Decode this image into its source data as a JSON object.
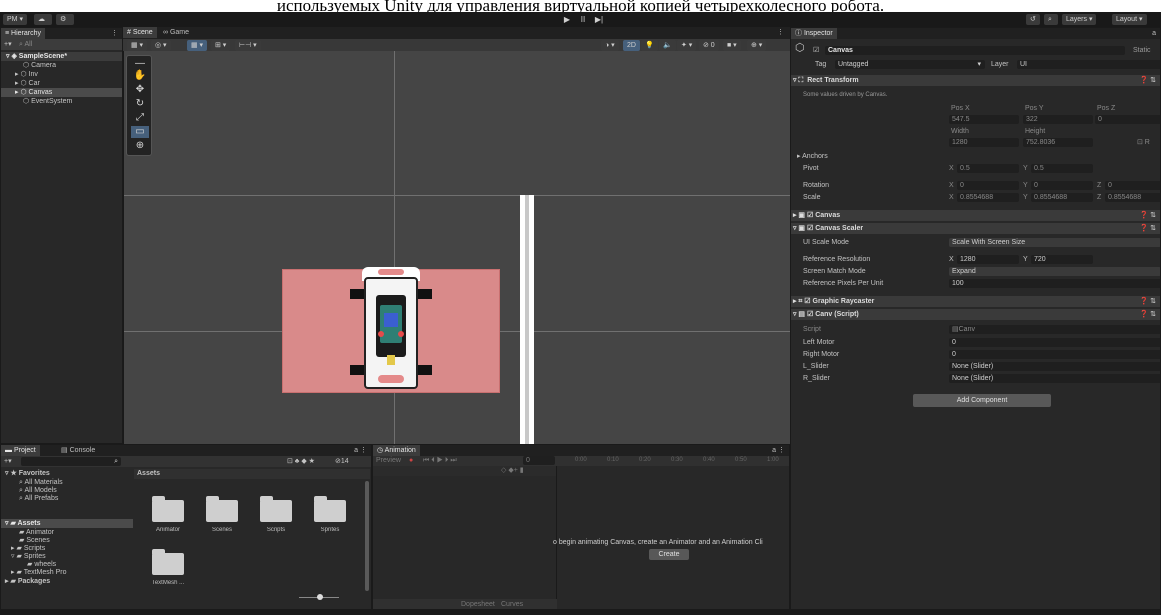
{
  "caption": "используемых Unity для управления виртуальной копией четырехколесного робота.",
  "toolbar": {
    "account": "PM ▾",
    "play_label": "▶",
    "pause_label": "II",
    "step_label": "▶|",
    "layers": "Layers",
    "layout": "Layout"
  },
  "hierarchy": {
    "tab": "Hierarchy",
    "search_placeholder": "All",
    "items": [
      {
        "label": "SampleScene*"
      },
      {
        "label": "Camera"
      },
      {
        "label": "Inv"
      },
      {
        "label": "Car"
      },
      {
        "label": "Canvas"
      },
      {
        "label": "EventSystem"
      }
    ]
  },
  "scene": {
    "tabs": [
      {
        "label": "Scene"
      },
      {
        "label": "Game"
      }
    ],
    "mode_2d": "2D"
  },
  "inspector": {
    "tab": "Inspector",
    "object_name": "Canvas",
    "static_label": "Static",
    "tag_label": "Tag",
    "tag_value": "Untagged",
    "layer_label": "Layer",
    "layer_value": "UI",
    "rect_transform": {
      "title": "Rect Transform",
      "note": "Some values driven by Canvas.",
      "posx_label": "Pos X",
      "posx": "547.5",
      "posy_label": "Pos Y",
      "posy": "322",
      "posz_label": "Pos Z",
      "posz": "0",
      "width_label": "Width",
      "width": "1280",
      "height_label": "Height",
      "height": "752.8036",
      "anchors": "Anchors",
      "pivot_label": "Pivot",
      "pivot_x": "0.5",
      "pivot_y": "0.5",
      "rotation_label": "Rotation",
      "rot_x": "0",
      "rot_y": "0",
      "rot_z": "0",
      "scale_label": "Scale",
      "scale_x": "0.8554688",
      "scale_y": "0.8554688",
      "scale_z": "0.8554688"
    },
    "canvas_title": "Canvas",
    "canvas_scaler": {
      "title": "Canvas Scaler",
      "ui_scale_mode_label": "UI Scale Mode",
      "ui_scale_mode": "Scale With Screen Size",
      "ref_res_label": "Reference Resolution",
      "ref_x": "1280",
      "ref_y": "720",
      "match_mode_label": "Screen Match Mode",
      "match_mode": "Expand",
      "ppu_label": "Reference Pixels Per Unit",
      "ppu": "100"
    },
    "graphic_raycaster": "Graphic Raycaster",
    "canv_script": {
      "title": "Canv (Script)",
      "script_label": "Script",
      "script_value": "Canv",
      "left_motor_label": "Left Motor",
      "left_motor": "0",
      "right_motor_label": "Right Motor",
      "right_motor": "0",
      "lslider_label": "L_Slider",
      "lslider": "None (Slider)",
      "rslider_label": "R_Slider",
      "rslider": "None (Slider)"
    },
    "add_component": "Add Component"
  },
  "project": {
    "tabs": [
      {
        "label": "Project"
      },
      {
        "label": "Console"
      }
    ],
    "count": "14",
    "favorites": "Favorites",
    "fav_items": [
      {
        "label": "All Materials"
      },
      {
        "label": "All Models"
      },
      {
        "label": "All Prefabs"
      }
    ],
    "assets": "Assets",
    "tree": [
      {
        "label": "Animator"
      },
      {
        "label": "Scenes"
      },
      {
        "label": "Scripts"
      },
      {
        "label": "Sprites"
      },
      {
        "label": "wheels"
      },
      {
        "label": "TextMesh Pro"
      }
    ],
    "packages": "Packages",
    "breadcrumb": "Assets",
    "folders": [
      {
        "label": "Animator"
      },
      {
        "label": "Scenes"
      },
      {
        "label": "Scripts"
      },
      {
        "label": "Sprites"
      },
      {
        "label": "TextMesh ..."
      }
    ]
  },
  "animation": {
    "tab": "Animation",
    "preview": "Preview",
    "frame": "0",
    "ticks": [
      "0:00",
      "0:10",
      "0:20",
      "0:30",
      "0:40",
      "0:50",
      "1:00"
    ],
    "message": "o begin animating Canvas, create an Animator and an Animation Cli",
    "create": "Create",
    "dopesheet": "Dopesheet",
    "curves": "Curves"
  },
  "colors": {
    "canvas_overlay": "#d98a8a",
    "selection": "#46607c",
    "background": "#282828"
  }
}
